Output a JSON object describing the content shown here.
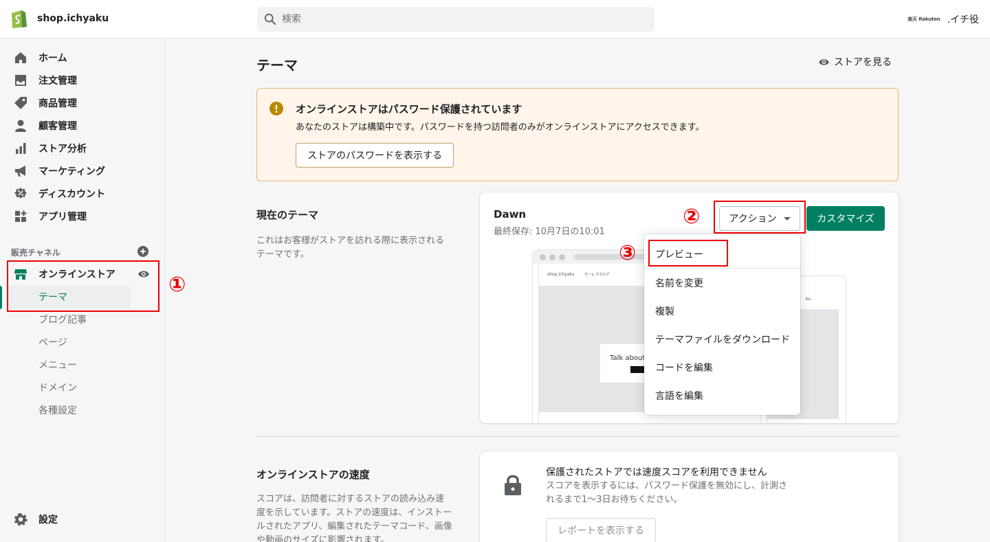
{
  "topbar": {
    "store_name": "shop.ichyaku",
    "search_placeholder": "検索",
    "account_logo": "楽天 Rakuten",
    "account_name": ".イチ役"
  },
  "sidebar": {
    "items": [
      {
        "label": "ホーム",
        "icon": "home-icon"
      },
      {
        "label": "注文管理",
        "icon": "orders-icon"
      },
      {
        "label": "商品管理",
        "icon": "tag-icon"
      },
      {
        "label": "顧客管理",
        "icon": "customer-icon"
      },
      {
        "label": "ストア分析",
        "icon": "analytics-icon"
      },
      {
        "label": "マーケティング",
        "icon": "megaphone-icon"
      },
      {
        "label": "ディスカウント",
        "icon": "discount-icon"
      },
      {
        "label": "アプリ管理",
        "icon": "apps-icon"
      }
    ],
    "channels_label": "販売チャネル",
    "online_store": "オンラインストア",
    "sub_items": [
      "テーマ",
      "ブログ記事",
      "ページ",
      "メニュー",
      "ドメイン",
      "各種設定"
    ],
    "settings": "設定"
  },
  "annotations": [
    "①",
    "②",
    "③"
  ],
  "main": {
    "title": "テーマ",
    "view_store": "ストアを見る",
    "banner": {
      "title": "オンラインストアはパスワード保護されています",
      "text": "あなたのストアは構築中です。パスワードを持つ訪問者のみがオンラインストアにアクセスできます。",
      "button": "ストアのパスワードを表示する"
    },
    "current_theme": {
      "section_title": "現在のテーマ",
      "section_desc": "これはお客様がストアを訪れる際に表示されるテーマです。",
      "name": "Dawn",
      "saved": "最終保存: 10月7日の10:01",
      "action_button": "アクション",
      "customize_button": "カスタマイズ",
      "preview": {
        "store_name": "shop.ichyaku",
        "nav_link": "ホーム  カタログ",
        "hero_text": "Talk about y",
        "mobile_text": "ku"
      }
    },
    "dropdown": [
      "プレビュー",
      "名前を変更",
      "複製",
      "テーマファイルをダウンロード",
      "コードを編集",
      "言語を編集"
    ],
    "speed": {
      "section_title": "オンラインストアの速度",
      "section_desc": "スコアは、訪問者に対するストアの読み込み速度を示しています。ストアの速度は、インストールされたアプリ、編集されたテーマコード、画像や動画のサイズに影響されます。",
      "card_title": "保護されたストアでは速度スコアを利用できません",
      "card_text": "スコアを表示するには、パスワード保護を無効にし、計測されるまで1〜3日お待ちください。",
      "report_button": "レポートを表示する"
    }
  },
  "colors": {
    "accent": "#008060",
    "annotation": "#ee0000",
    "banner_bg": "#fff5ea",
    "warning_icon": "#b98900"
  }
}
